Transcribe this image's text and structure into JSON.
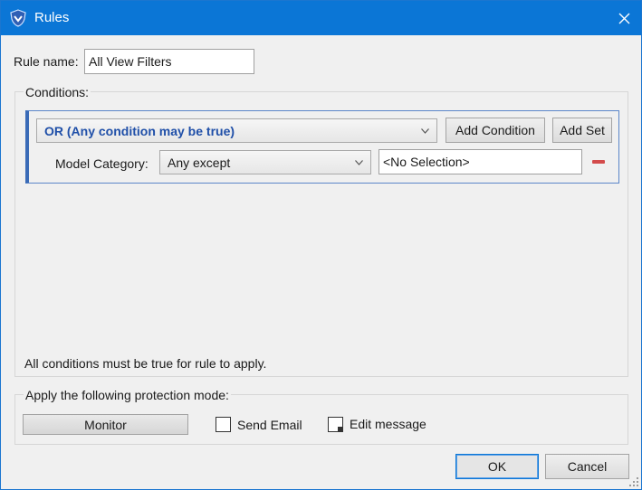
{
  "window": {
    "title": "Rules",
    "app_icon": "shield-logo-icon"
  },
  "rule_name": {
    "label": "Rule name:",
    "value": "All View Filters"
  },
  "conditions": {
    "group_label": "Conditions:",
    "set": {
      "operator": "OR (Any condition may be true)",
      "add_condition_label": "Add Condition",
      "add_set_label": "Add Set",
      "rows": [
        {
          "field_label": "Model Category:",
          "comparator": "Any except",
          "value": "<No Selection>"
        }
      ]
    },
    "footer_note": "All conditions must be true for rule to apply."
  },
  "protection": {
    "group_label": "Apply the following protection mode:",
    "mode_button": "Monitor",
    "send_email_label": "Send Email",
    "send_email_checked": false,
    "edit_message_label": "Edit message"
  },
  "buttons": {
    "ok": "OK",
    "cancel": "Cancel"
  },
  "colors": {
    "titlebar": "#0b76d6",
    "operator_text": "#1f4fa8",
    "remove": "#d34b4b"
  }
}
